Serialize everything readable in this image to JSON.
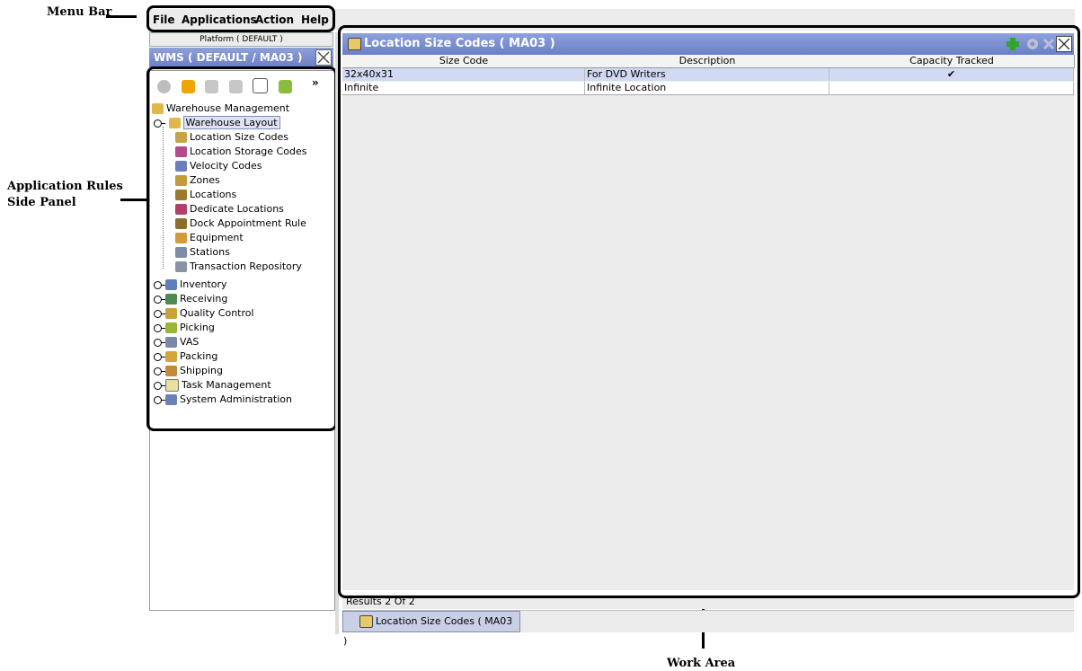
{
  "annotations": {
    "menu_bar": "Menu Bar",
    "side_panel_line1": "Application Rules",
    "side_panel_line2": "Side Panel",
    "work_area": "Work Area"
  },
  "menu": {
    "items": [
      {
        "label": "File"
      },
      {
        "label": "Applications"
      },
      {
        "label": "Action"
      },
      {
        "label": "Help"
      }
    ]
  },
  "left": {
    "platform_label": "Platform ( DEFAULT )",
    "wms_title": "WMS ( DEFAULT / MA03 )",
    "toolbar_icons": [
      "gear-icon",
      "hammer-icon",
      "stamp-icon",
      "stamp-icon",
      "document-icon",
      "truck-icon"
    ],
    "tree": {
      "root": "Warehouse Management",
      "selected": "Warehouse Layout",
      "layout_children": [
        "Location Size Codes",
        "Location Storage Codes",
        "Velocity Codes",
        "Zones",
        "Locations",
        "Dedicate Locations",
        "Dock Appointment Rule",
        "Equipment",
        "Stations",
        "Transaction Repository"
      ],
      "modules": [
        "Inventory",
        "Receiving",
        "Quality Control",
        "Picking",
        "VAS",
        "Packing",
        "Shipping",
        "Task Management",
        "System Administration"
      ]
    }
  },
  "work": {
    "title": "Location Size Codes ( MA03 )",
    "columns": [
      "Size Code",
      "Description",
      "Capacity Tracked"
    ],
    "rows": [
      {
        "code": "32x40x31",
        "description": "For DVD Writers",
        "tracked": "✔"
      },
      {
        "code": "Infinite",
        "description": "Infinite Location",
        "tracked": ""
      }
    ],
    "results": "Results 2  Of 2",
    "tab_label": "Location Size Codes ( MA03 )"
  },
  "colors": {
    "titlebar": "#6b7fc4",
    "selected_row": "#d2d9f2",
    "accent_green": "#2fa52f"
  }
}
